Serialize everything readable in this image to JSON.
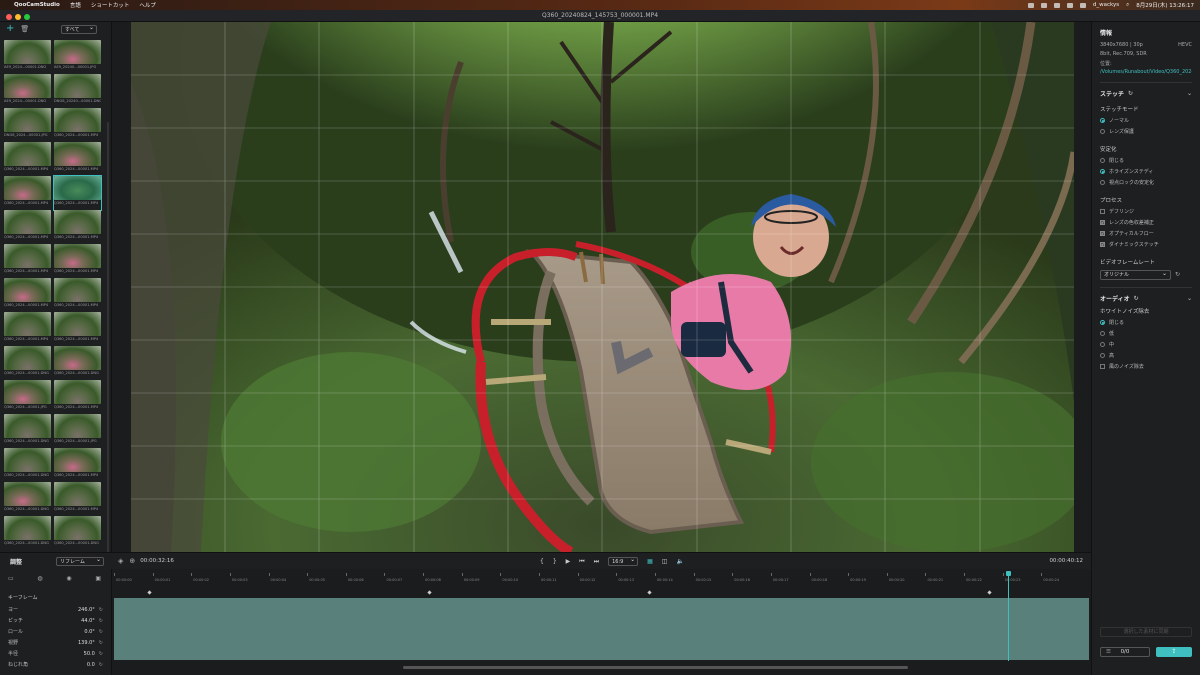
{
  "menubar": {
    "apple": "",
    "app": "QooCamStudio",
    "items": [
      "言語",
      "ショートカット",
      "ヘルプ"
    ],
    "user": "d_wackys",
    "datetime": "8月29日(木) 13:26:17"
  },
  "window": {
    "title": "Q360_20240824_145753_000001.MP4"
  },
  "library": {
    "filter": "すべて",
    "thumbs": [
      [
        "AE9_2024...00001.DNG",
        "AE9_20240...00001.JPG"
      ],
      [
        "AE9_2024...00001.DNG",
        "DNG8_20240...00001.DNG"
      ],
      [
        "DNG8_2024...00001.JPG",
        "Q360_2024...00001.MP4"
      ],
      [
        "Q360_2024...00001.MP4",
        "Q360_2024...00001.MP4"
      ],
      [
        "Q360_2024...00001.MP4",
        "Q360_2024...00001.MP4"
      ],
      [
        "Q360_2024...00001.MP4",
        "Q360_2024...00001.MP4"
      ],
      [
        "Q360_2024...00001.MP4",
        "Q360_2024...00001.MP4"
      ],
      [
        "Q360_2024...00001.MP4",
        "Q360_2024...00001.MP4"
      ],
      [
        "Q360_2024...00001.MP4",
        "Q360_2024...00001.MP4"
      ],
      [
        "Q360_2024...00001.DNG",
        "Q360_2024...00001.DNG"
      ],
      [
        "Q360_2024...00001.JPG",
        "Q360_2024...00001.MP4"
      ],
      [
        "Q360_2024...00001.DNG",
        "Q360_2024...00001.JPG"
      ],
      [
        "Q360_2024...00001.DNG",
        "Q360_2024...00001.MP4"
      ],
      [
        "Q360_2024...00001.DNG",
        "Q360_2024...00001.MP4"
      ],
      [
        "Q360_2024...00001.DNG",
        "Q360_2024...00001.DNG"
      ]
    ]
  },
  "info": {
    "heading": "情報",
    "resolution": "3840x7680 | 30p",
    "codec": "HEVC",
    "color": "8bit, Rec.709, SDR",
    "location_label": "位置:",
    "location": "/Volumes/Runabout/Video/Q360_20240..."
  },
  "stitch": {
    "heading": "ステッチ",
    "mode_label": "ステッチモード",
    "modes": [
      "ノーマル",
      "レンズ保護"
    ],
    "mode_selected": 0
  },
  "stabilization": {
    "label": "安定化",
    "options": [
      "閉じる",
      "ホライズンステディ",
      "視点ロックの安定化"
    ],
    "selected": 1
  },
  "process": {
    "label": "プロセス",
    "items": [
      {
        "label": "デフリンジ",
        "on": false
      },
      {
        "label": "レンズの色収差補正",
        "on": true
      },
      {
        "label": "オプティカルフロー",
        "on": true
      },
      {
        "label": "ダイナミックステッチ",
        "on": true
      }
    ]
  },
  "framerate": {
    "label": "ビデオフレームレート",
    "value": "オリジナル"
  },
  "audio": {
    "heading": "オーディオ",
    "noise_label": "ホワイトノイズ除去",
    "options": [
      "閉じる",
      "低",
      "中",
      "高"
    ],
    "selected": 0,
    "wind": "風のノイズ除去"
  },
  "actions": {
    "apply_selected": "選択した素材に同期",
    "count": "0/0",
    "export_icon": "share-icon"
  },
  "controls": {
    "panel_title": "調整",
    "mode": "リフレーム",
    "time_current": "00:00:32:16",
    "time_total": "00:00:40:12",
    "ratio": "16:9",
    "mark_in": "{",
    "mark_out": "}",
    "play": "▶"
  },
  "keyframe": {
    "title": "キーフレーム",
    "params": [
      {
        "label": "ヨー",
        "value": "246.0°"
      },
      {
        "label": "ピッチ",
        "value": "44.0°"
      },
      {
        "label": "ロール",
        "value": "0.0°"
      },
      {
        "label": "視野",
        "value": "139.0°"
      },
      {
        "label": "半径",
        "value": "50.0"
      },
      {
        "label": "ねじれ角",
        "value": "0.0"
      }
    ]
  },
  "timeline": {
    "labels": [
      "00:00:00",
      "00:00:01",
      "00:00:02",
      "00:00:03",
      "00:00:04",
      "00:00:05",
      "00:00:06",
      "00:00:07",
      "00:00:08",
      "00:00:09",
      "00:00:10",
      "00:00:11",
      "00:00:12",
      "00:00:13",
      "00:00:14",
      "00:00:15",
      "00:00:16",
      "00:00:17",
      "00:00:18",
      "00:00:19",
      "00:00:20",
      "00:00:21",
      "00:00:22",
      "00:00:23",
      "00:00:24"
    ]
  },
  "colors": {
    "accent": "#3fbfc0",
    "track": "#5a807c",
    "rail": "#c8202a"
  }
}
